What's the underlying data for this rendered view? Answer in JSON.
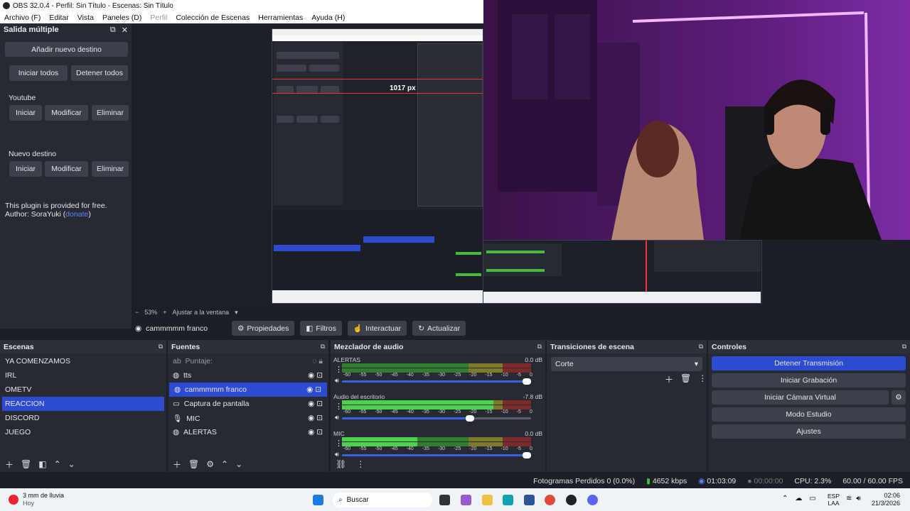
{
  "window": {
    "title": "OBS 32.0.4 - Perfil: Sin Título - Escenas: Sin Título"
  },
  "menu": {
    "items": [
      "Archivo (F)",
      "Editar",
      "Vista",
      "Paneles (D)",
      "Perfil",
      "Colección de Escenas",
      "Herramientas",
      "Ayuda (H)"
    ]
  },
  "multi_output": {
    "title": "Salida múltiple",
    "add_label": "Añadir nuevo destino",
    "start_all": "Iniciar todos",
    "stop_all": "Detener todos",
    "destinations": [
      {
        "name": "Youtube",
        "start": "Iniciar",
        "modify": "Modificar",
        "delete": "Eliminar"
      },
      {
        "name": "Nuevo destino",
        "start": "Iniciar",
        "modify": "Modificar",
        "delete": "Eliminar"
      }
    ],
    "note_line1": "This plugin is provided for free.",
    "note_author_prefix": "Author: SoraYuki (",
    "note_link": "donate",
    "note_suffix": ")"
  },
  "preview": {
    "measure_label": "1017 px",
    "zoom": "53%",
    "fit_label": "Ajustar a la ventana"
  },
  "source_toolbar": {
    "source_name": "cammmmm franco",
    "properties": "Propiedades",
    "filters": "Filtros",
    "interact": "Interactuar",
    "refresh": "Actualizar"
  },
  "scenes": {
    "title": "Escenas",
    "items": [
      "YA COMENZAMOS",
      "IRL",
      "OMETV",
      "REACCION",
      "DISCORD",
      "JUEGO"
    ],
    "selected": "REACCION"
  },
  "sources": {
    "title": "Fuentes",
    "items": [
      "Puntaje:",
      "tts",
      "cammmmm franco",
      "Captura de pantalla",
      "MIC",
      "ALERTAS"
    ],
    "selected": "cammmmm franco"
  },
  "mixer": {
    "title": "Mezclador de audio",
    "scale": [
      "-60",
      "-55",
      "-50",
      "-45",
      "-40",
      "-35",
      "-30",
      "-25",
      "-20",
      "-15",
      "-10",
      "-5",
      "0"
    ],
    "channels": [
      {
        "name": "ALERTAS",
        "db": "0.0 dB",
        "level": 0.0,
        "fader": 1.0
      },
      {
        "name": "Audio del escritorio",
        "db": "-7.8 dB",
        "level": 0.8,
        "fader": 0.7
      },
      {
        "name": "MIC",
        "db": "0.0 dB",
        "level": 0.4,
        "fader": 1.0
      }
    ]
  },
  "transitions": {
    "title": "Transiciones de escena",
    "current": "Corte"
  },
  "controls": {
    "title": "Controles",
    "stop_stream": "Detener Transmisión",
    "start_record": "Iniciar Grabación",
    "virtual_cam": "Iniciar Cámara Virtual",
    "studio_mode": "Modo Estudio",
    "settings": "Ajustes"
  },
  "status": {
    "dropped": "Fotogramas Perdidos 0 (0.0%)",
    "bitrate": "4652 kbps",
    "stream_time": "01:03:09",
    "rec_time": "00:00:00",
    "cpu": "CPU: 2.3%",
    "fps": "60.00 / 60.00 FPS"
  },
  "taskbar": {
    "weather": "3 mm de lluvia",
    "weather_sub": "Hoy",
    "search": "Buscar",
    "lang": "ESP",
    "lang_sub": "LAA",
    "time": "02:06",
    "date": "21/3/2026"
  },
  "colors": {
    "accent": "#2c4bd0",
    "panel": "#272a33",
    "background": "#1d1f26",
    "button": "#3c404b",
    "live_green": "#3fbf3f",
    "neon_pink": "#c23de0"
  }
}
